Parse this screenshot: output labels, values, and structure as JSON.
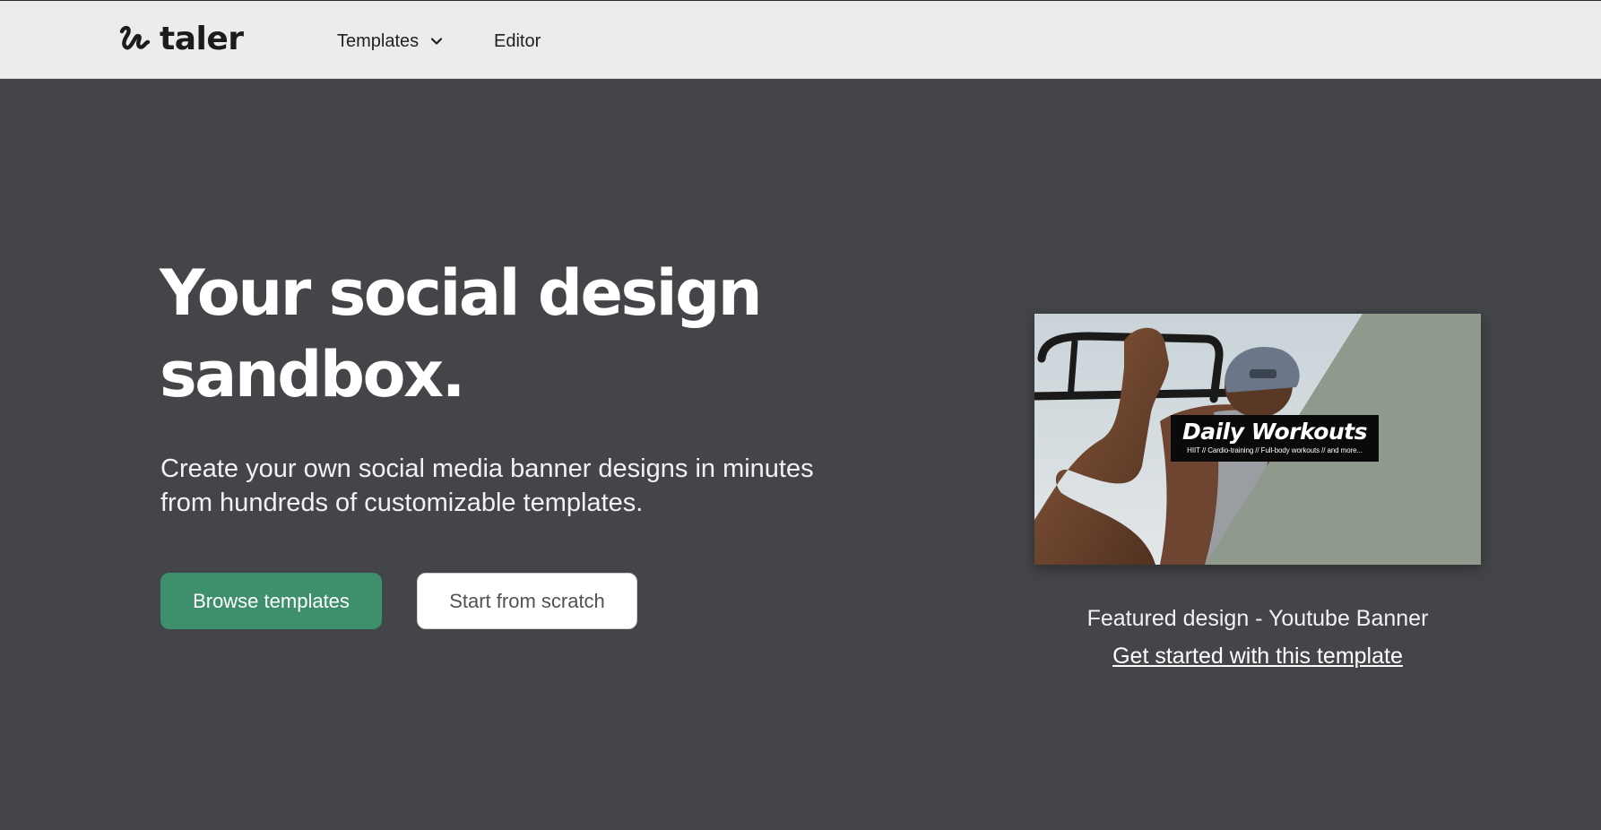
{
  "header": {
    "logo_text": "taler",
    "logo_icon": "taler-squiggle-icon",
    "nav": {
      "templates_label": "Templates",
      "templates_icon": "chevron-down-icon",
      "editor_label": "Editor"
    }
  },
  "hero": {
    "title_line1": "Your social design",
    "title_line2": "sandbox.",
    "subtitle_line1": "Create your own social media banner designs in minutes",
    "subtitle_line2": "from hundreds of customizable templates.",
    "primary_button": "Browse templates",
    "secondary_button": "Start from scratch"
  },
  "featured": {
    "banner_title": "Daily Workouts",
    "banner_tagline": "HIIT // Cardio-training // Full-body workouts // and more...",
    "caption": "Featured design - Youtube Banner",
    "link": "Get started with this template"
  },
  "colors": {
    "page_background": "#434549",
    "header_background": "#ebeceb",
    "primary_button": "#3e8f6b",
    "banner_panel": "#8f998c"
  }
}
